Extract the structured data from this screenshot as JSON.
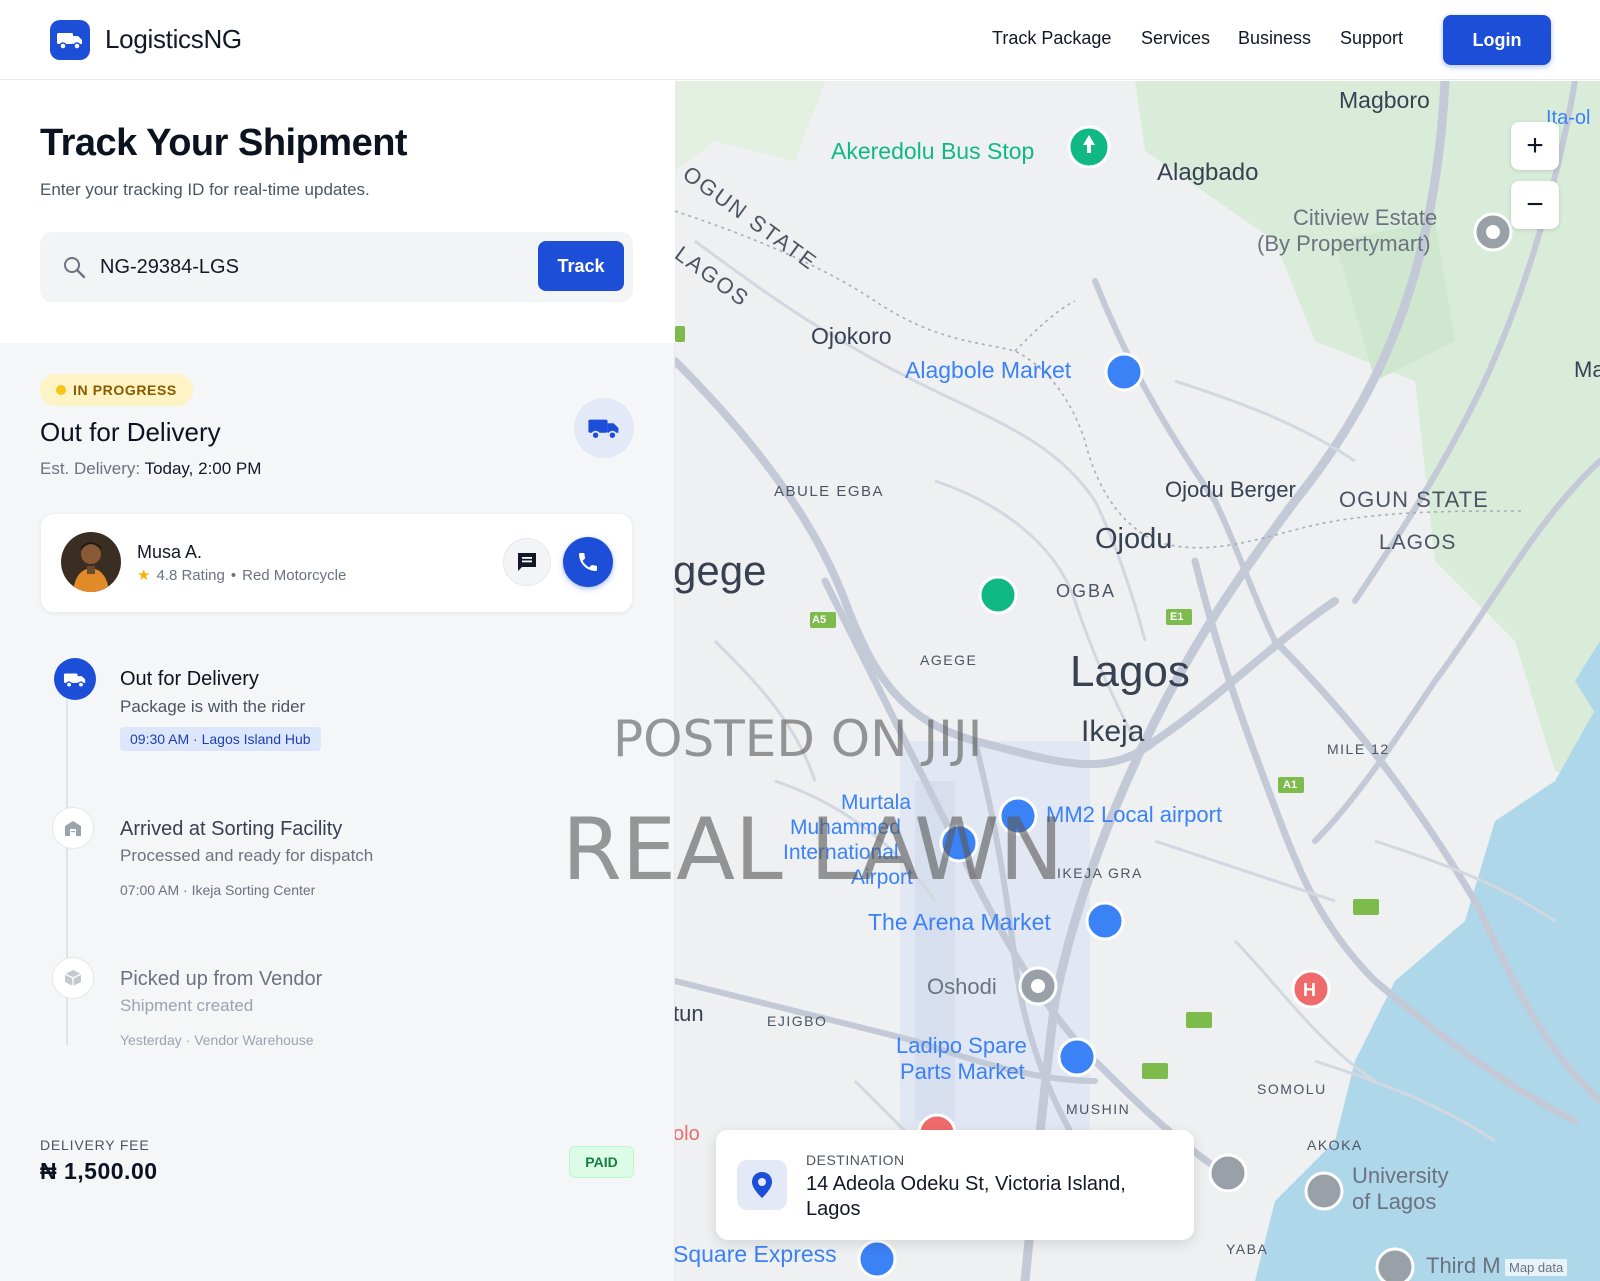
{
  "header": {
    "brand": "LogisticsNG",
    "nav": [
      "Track Package",
      "Services",
      "Business",
      "Support"
    ],
    "login_label": "Login"
  },
  "tracking": {
    "title": "Track Your Shipment",
    "subtitle": "Enter your tracking ID for real-time updates.",
    "input_value": "NG-29384-LGS",
    "track_label": "Track"
  },
  "shipment": {
    "status_badge": "IN PROGRESS",
    "status_title": "Out for Delivery",
    "eta_label": "Est. Delivery:",
    "eta_value": "Today, 2:00 PM"
  },
  "rider": {
    "name": "Musa A.",
    "rating": "4.8 Rating",
    "separator": "•",
    "vehicle": "Red Motorcycle"
  },
  "timeline": [
    {
      "title": "Out for Delivery",
      "desc": "Package is with the rider",
      "meta": "09:30 AM · Lagos Island Hub",
      "icon": "truck-icon"
    },
    {
      "title": "Arrived at Sorting Facility",
      "desc": "Processed and ready for dispatch",
      "meta": "07:00 AM · Ikeja Sorting Center",
      "icon": "warehouse-icon"
    },
    {
      "title": "Picked up from Vendor",
      "desc": "Shipment created",
      "meta": "Yesterday · Vendor Warehouse",
      "icon": "package-icon"
    }
  ],
  "fee": {
    "label": "DELIVERY FEE",
    "value": "₦ 1,500.00",
    "status": "PAID"
  },
  "map": {
    "labels": {
      "magboro": "Magboro",
      "akeredolu": "Akeredolu Bus Stop",
      "alagbado": "Alagbado",
      "citiview_1": "Citiview Estate",
      "citiview_2": "(By Propertymart)",
      "ogun_state_diag": "OGUN STATE",
      "lagos_diag": "LAGOS",
      "ojokoro": "Ojokoro",
      "alagbole": "Alagbole Market",
      "abule_egba": "ABULE EGBA",
      "ojodu_berger": "Ojodu Berger",
      "ogun_state": "OGUN STATE",
      "lagos_state": "LAGOS",
      "ojodu": "Ojodu",
      "agege_partial": "gege",
      "ogba": "OGBA",
      "agege": "AGEGE",
      "lagos_city": "Lagos",
      "ikeja": "Ikeja",
      "mile12": "MILE 12",
      "murtala_1": "Murtala",
      "murtala_2": "Muhammed",
      "murtala_3": "International",
      "murtala_4": "Airport",
      "mm2": "MM2 Local airport",
      "ikeja_gra": "IKEJA GRA",
      "arena": "The Arena Market",
      "oshodi": "Oshodi",
      "ejigbo": "EJIGBO",
      "itun_partial": "tun",
      "ladipo_1": "Ladipo Spare",
      "ladipo_2": "Parts Market",
      "mushin": "MUSHIN",
      "somolu": "SOMOLU",
      "akoka": "AKOKA",
      "unilag_1": "University",
      "unilag_2": "of Lagos",
      "yaba": "YABA",
      "square_express": "Square Express",
      "third_m": "Third M",
      "map_data": "Map data",
      "ita_o": "Ita-ol",
      "ma": "Ma",
      "olo": "olo",
      "lagos_small": "LAGOS",
      "a5": "A5",
      "e1": "E1",
      "a1": "A1"
    },
    "zoom_in": "+",
    "zoom_out": "−",
    "destination_label": "DESTINATION",
    "destination_address": "14 Adeola Odeku St, Victoria Island, Lagos",
    "colors": {
      "water": "#aed8ea",
      "park": "#d6ebd8",
      "road": "#c2c8d6",
      "poi_blue": "#3b82f6",
      "poi_green": "#10b981"
    }
  },
  "watermark": {
    "line1": "POSTED ON JIJI",
    "line2": "REAL LAWN"
  },
  "colors": {
    "primary": "#1d4ed8",
    "badge_bg": "#fdf3c4",
    "paid_bg": "#dcfce7"
  }
}
